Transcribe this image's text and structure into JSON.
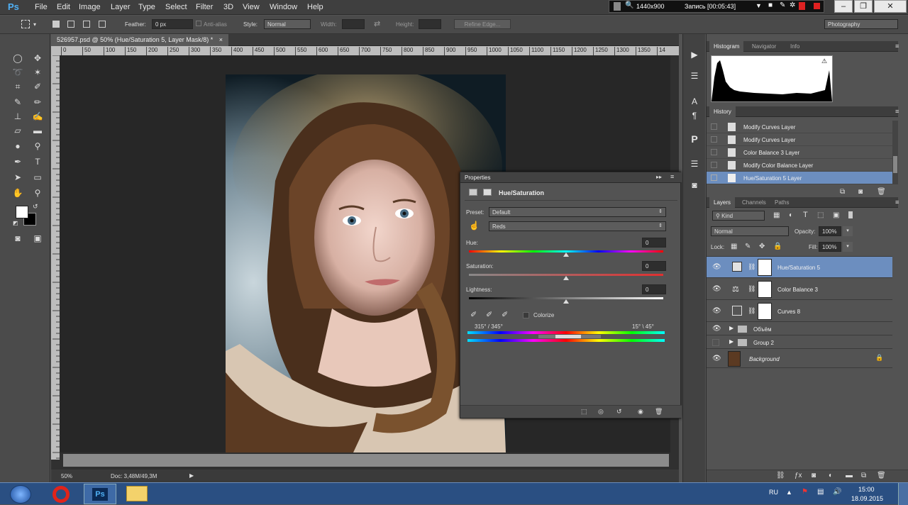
{
  "app": {
    "logo": "Ps"
  },
  "menu": [
    "File",
    "Edit",
    "Image",
    "Layer",
    "Type",
    "Select",
    "Filter",
    "3D",
    "View",
    "Window",
    "Help"
  ],
  "recorder": {
    "resolution": "1440x900",
    "status": "Запись [00:05:43]"
  },
  "window_controls": {
    "minimize": "–",
    "restore": "❐",
    "close": "✕"
  },
  "options": {
    "feather_label": "Feather:",
    "feather_value": "0 px",
    "antialias_label": "Anti-alias",
    "style_label": "Style:",
    "style_value": "Normal",
    "width_label": "Width:",
    "height_label": "Height:",
    "refine_edge": "Refine Edge...",
    "workspace": "Photography"
  },
  "document": {
    "tab_title": "526957.psd @ 50% (Hue/Saturation 5, Layer Mask/8) *",
    "tab_close": "×",
    "zoom": "50%",
    "doc_size": "Doc: 3,48M/49,3M",
    "ruler_marks": [
      "0",
      "50",
      "100",
      "150",
      "200",
      "250",
      "300",
      "350",
      "400",
      "450",
      "500",
      "550",
      "600",
      "650",
      "700",
      "750",
      "800",
      "850",
      "900",
      "950",
      "1000",
      "1050",
      "1100",
      "1150",
      "1200",
      "1250",
      "1300",
      "1350",
      "14"
    ]
  },
  "properties": {
    "panel_title": "Properties",
    "adjustment": "Hue/Saturation",
    "preset_label": "Preset:",
    "preset_value": "Default",
    "channel_value": "Reds",
    "hue_label": "Hue:",
    "hue_value": "0",
    "saturation_label": "Saturation:",
    "saturation_value": "0",
    "lightness_label": "Lightness:",
    "lightness_value": "0",
    "colorize_label": "Colorize",
    "range_left": "315° / 345°",
    "range_right": "15° \\ 45°"
  },
  "histogram_tabs": [
    "Histogram",
    "Navigator",
    "Info"
  ],
  "history": {
    "tab": "History",
    "items": [
      "Modify Curves Layer",
      "Modify Curves Layer",
      "Color Balance 3 Layer",
      "Modify Color Balance Layer",
      "Hue/Saturation 5 Layer"
    ]
  },
  "layers": {
    "tabs": [
      "Layers",
      "Channels",
      "Paths"
    ],
    "kind": "Kind",
    "blend_mode": "Normal",
    "opacity_label": "Opacity:",
    "opacity_value": "100%",
    "lock_label": "Lock:",
    "fill_label": "Fill:",
    "fill_value": "100%",
    "items": [
      {
        "name": "Hue/Saturation 5"
      },
      {
        "name": "Color Balance 3"
      },
      {
        "name": "Curves 8"
      },
      {
        "name": "Объём"
      },
      {
        "name": "Group 2"
      },
      {
        "name": "Background"
      }
    ]
  },
  "taskbar": {
    "lang": "RU",
    "time": "15:00",
    "date": "18.09.2015"
  },
  "colors": {
    "accent": "#6c8ebf",
    "panel": "#535353",
    "dark": "#303030"
  }
}
